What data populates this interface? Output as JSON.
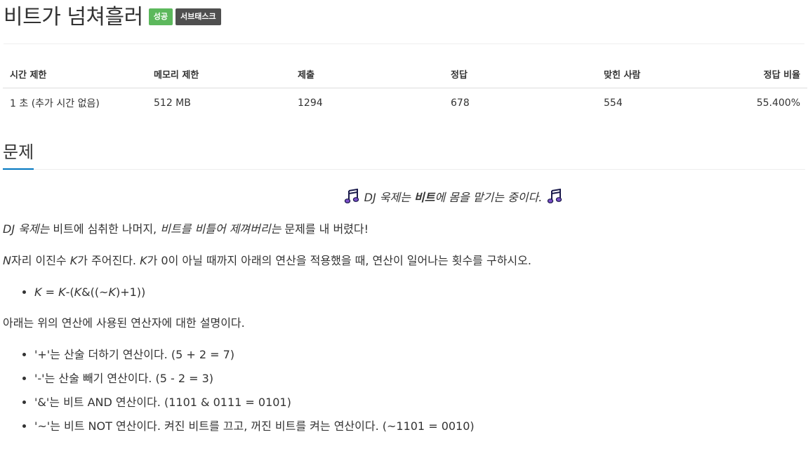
{
  "header": {
    "title": "비트가 넘쳐흘러",
    "badges": {
      "success": "성공",
      "subtask": "서브태스크"
    }
  },
  "info_table": {
    "headers": [
      "시간 제한",
      "메모리 제한",
      "제출",
      "정답",
      "맞힌 사람",
      "정답 비율"
    ],
    "values": [
      "1 초 (추가 시간 없음)",
      "512 MB",
      "1294",
      "678",
      "554",
      "55.400%"
    ]
  },
  "section": {
    "title": "문제"
  },
  "problem": {
    "line1": {
      "icon": "music-notes-icon",
      "a": "DJ 욱제는 ",
      "b": "비트",
      "c": "에 몸을 맡기는 중이다."
    },
    "line2": {
      "a": "DJ 욱제는",
      "b": " 비트에 심취한 나머지, ",
      "c": "비트를 비틀어 제껴버리는",
      "d": " 문제를 내 버렸다!"
    },
    "line3": {
      "n": "N",
      "a": "자리 이진수 ",
      "k1": "K",
      "b": "가 주어진다. ",
      "k2": "K",
      "c": "가 0이 아닐 때까지 아래의 연산을 적용했을 때, 연산이 일어나는 횟수를 구하시오."
    },
    "formula": {
      "k1": "K",
      "a": " = ",
      "k2": "K",
      "b": "-(",
      "k3": "K",
      "c": "&((~",
      "k4": "K",
      "d": ")+1))"
    },
    "ops_intro": "아래는 위의 연산에 사용된 연산자에 대한 설명이다.",
    "ops": [
      "'+'는 산술 더하기 연산이다. (5 + 2 = 7)",
      "'-'는 산술 빼기 연산이다. (5 - 2 = 3)",
      "'&'는 비트 AND 연산이다. (1101 & 0111 = 0101)",
      "'~'는 비트 NOT 연산이다. 켜진 비트를 끄고, 꺼진 비트를 켜는 연산이다. (~1101 = 0010)"
    ]
  }
}
